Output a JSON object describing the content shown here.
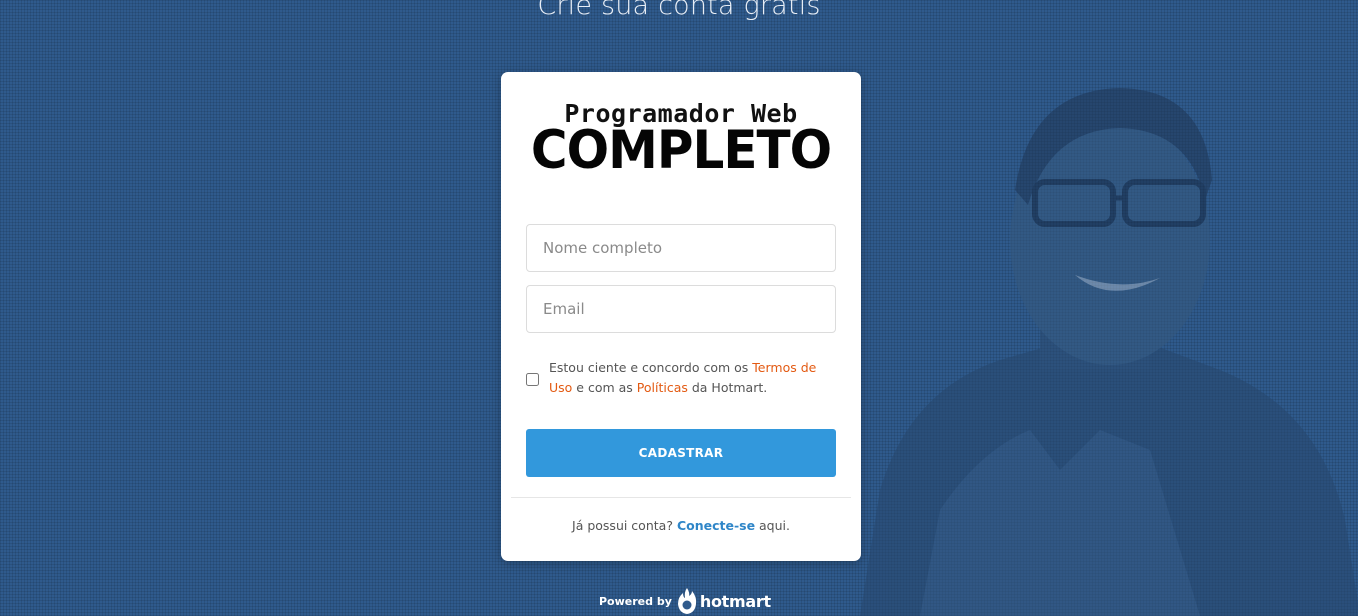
{
  "header": {
    "title": "Crie sua conta grátis"
  },
  "logo": {
    "line1": "Programador Web",
    "line2": "COMPLETO"
  },
  "form": {
    "name_placeholder": "Nome completo",
    "email_placeholder": "Email",
    "terms": {
      "prefix": "Estou ciente e concordo com os ",
      "terms_link": "Termos de Uso",
      "middle": " e com as ",
      "policies_link": "Políticas",
      "suffix": " da Hotmart."
    },
    "submit_label": "CADASTRAR"
  },
  "footer": {
    "prefix": "Já possui conta? ",
    "link": "Conecte-se",
    "suffix": " aqui.",
    "powered_by": "Powered by",
    "brand": "hotmart"
  },
  "colors": {
    "background": "#2f5a8c",
    "button": "#3298dc",
    "link_orange": "#e35a12",
    "link_blue": "#2f86c8"
  }
}
